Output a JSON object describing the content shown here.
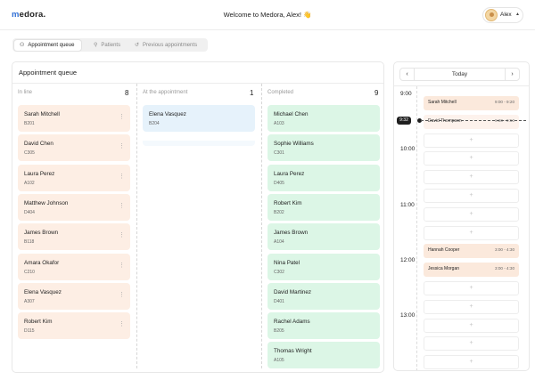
{
  "header": {
    "logo_prefix": "m",
    "logo_rest": "edora.",
    "welcome": "Welcome to Medora, Alex! 👋",
    "user_name": "Alex",
    "user_caret": "▲"
  },
  "tabs": [
    {
      "label": "Appointment queue",
      "icon": "people-icon",
      "active": true
    },
    {
      "label": "Patients",
      "icon": "person-icon",
      "active": false
    },
    {
      "label": "Previous appointments",
      "icon": "history-icon",
      "active": false
    }
  ],
  "queue": {
    "title": "Appointment queue",
    "columns": [
      {
        "label": "In line",
        "count": "8",
        "cards": [
          {
            "name": "Sarah Mitchell",
            "code": "B201"
          },
          {
            "name": "David Chen",
            "code": "C305"
          },
          {
            "name": "Laura Perez",
            "code": "A102"
          },
          {
            "name": "Matthew Johnson",
            "code": "D404"
          },
          {
            "name": "James Brown",
            "code": "B118"
          },
          {
            "name": "Amara Okafor",
            "code": "C210"
          },
          {
            "name": "Elena Vasquez",
            "code": "A307"
          },
          {
            "name": "Robert Kim",
            "code": "D115"
          }
        ]
      },
      {
        "label": "At the appointment",
        "count": "1",
        "cards": [
          {
            "name": "Elena Vasquez",
            "code": "B204"
          }
        ]
      },
      {
        "label": "Completed",
        "count": "9",
        "cards": [
          {
            "name": "Michael Chen",
            "code": "A103"
          },
          {
            "name": "Sophie Williams",
            "code": "C301"
          },
          {
            "name": "Laura Perez",
            "code": "D405"
          },
          {
            "name": "Robert Kim",
            "code": "B202"
          },
          {
            "name": "James Brown",
            "code": "A104"
          },
          {
            "name": "Nina Patel",
            "code": "C302"
          },
          {
            "name": "David Martinez",
            "code": "D401"
          },
          {
            "name": "Rachel Adams",
            "code": "B205"
          },
          {
            "name": "Thomas Wright",
            "code": "A105"
          }
        ]
      }
    ],
    "menu_glyph": "⋮"
  },
  "calendar": {
    "prev": "‹",
    "next": "›",
    "label": "Today",
    "hours": [
      "9:00",
      "10:00",
      "11:00",
      "12:00",
      "13:00"
    ],
    "now": "9:32",
    "add_glyph": "+",
    "appointments": [
      {
        "name": "Sarah Mitchell",
        "time": "9:00 - 9:20"
      },
      {
        "name": "David Thompson",
        "time": "9:30 - 9:50"
      },
      {
        "name": "Hannah Cooper",
        "time": "3:00 - 4:30"
      },
      {
        "name": "Jessica Morgan",
        "time": "3:00 - 4:30"
      }
    ]
  },
  "colors": {
    "in_line": "#fdeee4",
    "at_appointment": "#e6f2fb",
    "completed": "#dcf6e6",
    "accent": "#2f6fd6"
  }
}
